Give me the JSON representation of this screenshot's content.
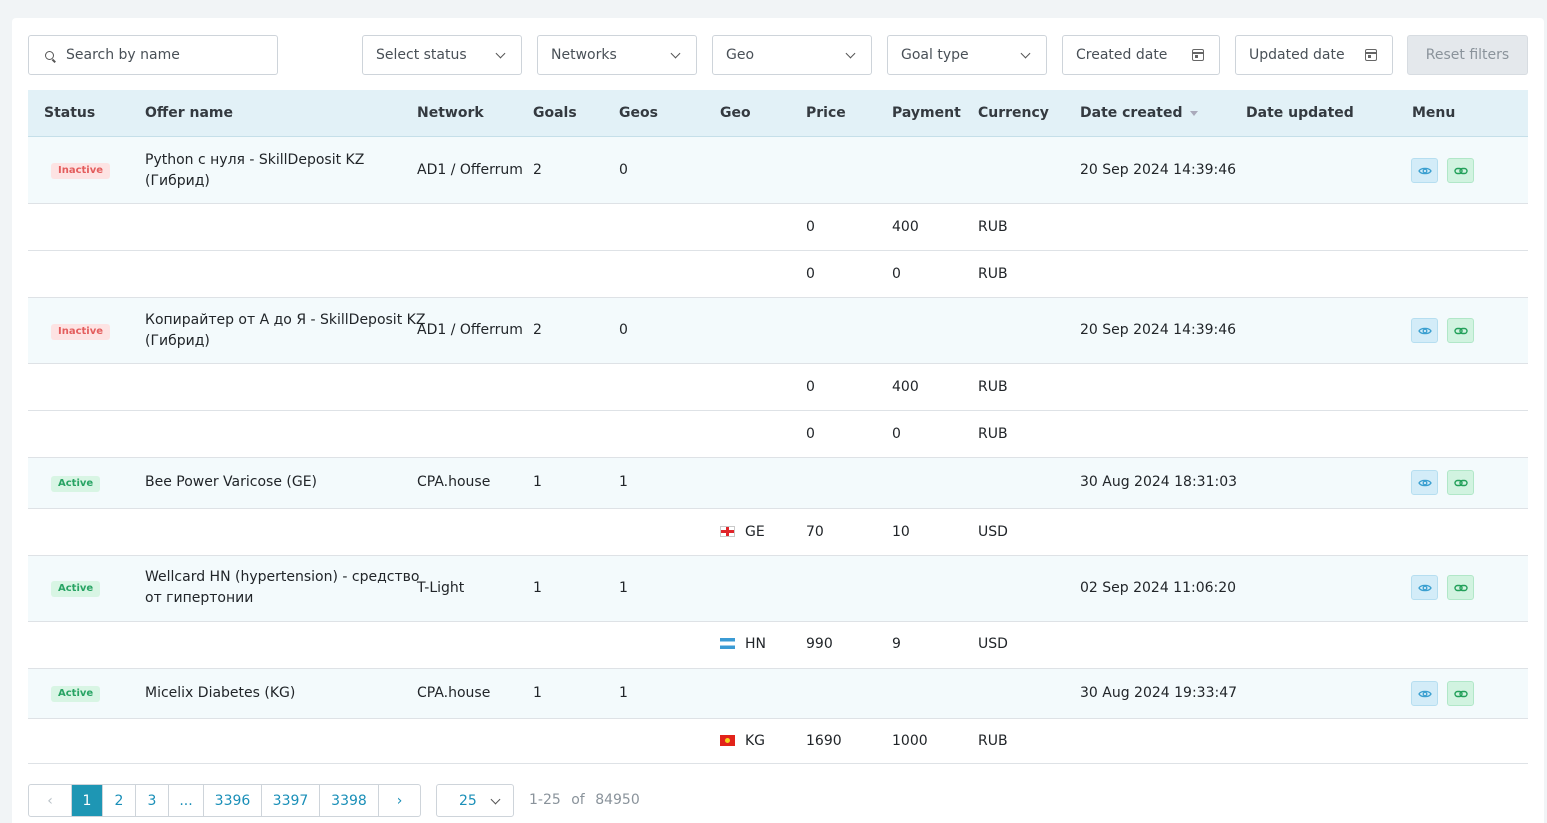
{
  "filters": {
    "search_placeholder": "Search by name",
    "status": "Select status",
    "networks": "Networks",
    "geo": "Geo",
    "goal_type": "Goal type",
    "created_date": "Created date",
    "updated_date": "Updated date",
    "reset": "Reset filters"
  },
  "table": {
    "headers": {
      "status": "Status",
      "offer_name": "Offer name",
      "network": "Network",
      "goals": "Goals",
      "geos": "Geos",
      "geo": "Geo",
      "price": "Price",
      "payment": "Payment",
      "currency": "Currency",
      "date_created": "Date created",
      "date_updated": "Date updated",
      "menu": "Menu"
    },
    "offers": [
      {
        "status": "Inactive",
        "name_line1": "Python с нуля - SkillDeposit KZ",
        "name_line2": "(Гибрид)",
        "network": "AD1 / Offerrum",
        "goals": "2",
        "geos": "0",
        "date_created": "20 Sep 2024 14:39:46",
        "goals_rows": [
          {
            "geo": "",
            "price": "0",
            "payment": "400",
            "currency": "RUB"
          },
          {
            "geo": "",
            "price": "0",
            "payment": "0",
            "currency": "RUB"
          }
        ]
      },
      {
        "status": "Inactive",
        "name_line1": "Копирайтер от А до Я - SkillDeposit KZ",
        "name_line2": "(Гибрид)",
        "network": "AD1 / Offerrum",
        "goals": "2",
        "geos": "0",
        "date_created": "20 Sep 2024 14:39:46",
        "goals_rows": [
          {
            "geo": "",
            "price": "0",
            "payment": "400",
            "currency": "RUB"
          },
          {
            "geo": "",
            "price": "0",
            "payment": "0",
            "currency": "RUB"
          }
        ]
      },
      {
        "status": "Active",
        "name_line1": "Bee Power Varicose (GE)",
        "name_line2": "",
        "network": "CPA.house",
        "goals": "1",
        "geos": "1",
        "date_created": "30 Aug 2024 18:31:03",
        "goals_rows": [
          {
            "geo": "GE",
            "price": "70",
            "payment": "10",
            "currency": "USD"
          }
        ]
      },
      {
        "status": "Active",
        "name_line1": "Wellcard HN (hypertension) - средство",
        "name_line2": "от гипертонии",
        "network": "T-Light",
        "goals": "1",
        "geos": "1",
        "date_created": "02 Sep 2024 11:06:20",
        "goals_rows": [
          {
            "geo": "HN",
            "price": "990",
            "payment": "9",
            "currency": "USD"
          }
        ]
      },
      {
        "status": "Active",
        "name_line1": "Micelix Diabetes (KG)",
        "name_line2": "",
        "network": "CPA.house",
        "goals": "1",
        "geos": "1",
        "date_created": "30 Aug 2024 19:33:47",
        "goals_rows": [
          {
            "geo": "KG",
            "price": "1690",
            "payment": "1000",
            "currency": "RUB"
          }
        ]
      }
    ]
  },
  "pagination": {
    "prev": "‹",
    "pages": [
      "1",
      "2",
      "3",
      "...",
      "3396",
      "3397",
      "3398"
    ],
    "next": "›",
    "per_page": "25",
    "range": "1-25",
    "of": "of",
    "total": "84950"
  },
  "colors": {
    "accent": "#1e96b4",
    "header_bg": "#e2f1f7",
    "inactive": "#e35d5d",
    "active": "#28a464"
  },
  "icons": {
    "view": "eye-icon",
    "link": "link-icon",
    "search": "search-icon",
    "calendar": "calendar-icon",
    "dropdown": "chevron-down-icon"
  }
}
